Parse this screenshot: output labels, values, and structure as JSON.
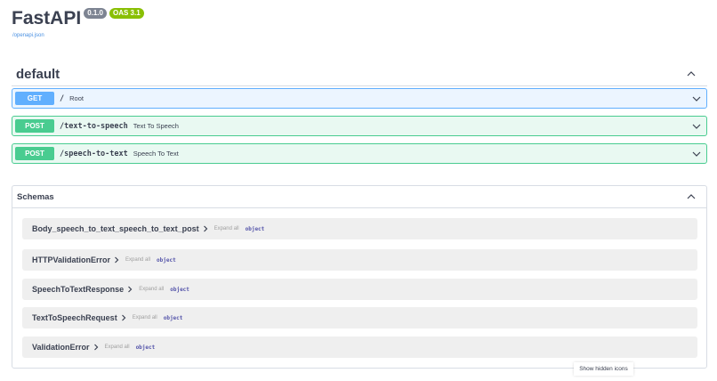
{
  "info": {
    "title": "FastAPI",
    "version": "0.1.0",
    "oas": "OAS 3.1",
    "openapi_link": "/openapi.json"
  },
  "tag": {
    "name": "default"
  },
  "operations": [
    {
      "method": "GET",
      "path": "/",
      "summary": "Root"
    },
    {
      "method": "POST",
      "path": "/text-to-speech",
      "summary": "Text To Speech"
    },
    {
      "method": "POST",
      "path": "/speech-to-text",
      "summary": "Speech To Text"
    }
  ],
  "schemas": {
    "title": "Schemas",
    "models": [
      {
        "name": "Body_speech_to_text_speech_to_text_post",
        "expand": "Expand all",
        "type": "object"
      },
      {
        "name": "HTTPValidationError",
        "expand": "Expand all",
        "type": "object"
      },
      {
        "name": "SpeechToTextResponse",
        "expand": "Expand all",
        "type": "object"
      },
      {
        "name": "TextToSpeechRequest",
        "expand": "Expand all",
        "type": "object"
      },
      {
        "name": "ValidationError",
        "expand": "Expand all",
        "type": "object"
      }
    ]
  },
  "hidden_icons_button": "Show hidden icons",
  "colors": {
    "get": "#61affe",
    "post": "#49cc90",
    "oas_badge": "#89bf04",
    "version_badge": "#7d8492"
  }
}
